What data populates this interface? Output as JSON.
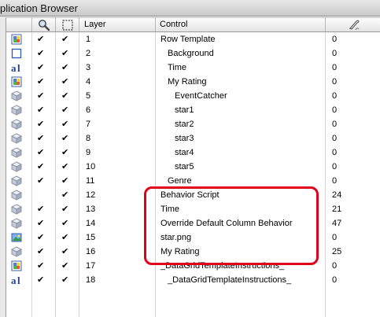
{
  "window": {
    "title": "plication Browser"
  },
  "columns": {
    "icon": "",
    "visible_icon": "magnifier-icon",
    "selectable_icon": "dashed-square-icon",
    "layer": "Layer",
    "control": "Control",
    "script_icon": "script-icon"
  },
  "rows": [
    {
      "icon": "group-icon",
      "vis": "✔",
      "sel": "✔",
      "layer": "1",
      "control": "Row Template",
      "lines": "0"
    },
    {
      "icon": "graphic-icon",
      "vis": "✔",
      "sel": "✔",
      "layer": "2",
      "control": "Background",
      "lines": "0"
    },
    {
      "icon": "field-icon",
      "vis": "✔",
      "sel": "✔",
      "layer": "3",
      "control": "Time",
      "lines": "0"
    },
    {
      "icon": "group-icon",
      "vis": "✔",
      "sel": "✔",
      "layer": "4",
      "control": "My Rating",
      "lines": "0"
    },
    {
      "icon": "button-icon",
      "vis": "✔",
      "sel": "✔",
      "layer": "5",
      "control": "EventCatcher",
      "lines": "0"
    },
    {
      "icon": "button-icon",
      "vis": "✔",
      "sel": "✔",
      "layer": "6",
      "control": "star1",
      "lines": "0"
    },
    {
      "icon": "button-icon",
      "vis": "✔",
      "sel": "✔",
      "layer": "7",
      "control": "star2",
      "lines": "0"
    },
    {
      "icon": "button-icon",
      "vis": "✔",
      "sel": "✔",
      "layer": "8",
      "control": "star3",
      "lines": "0"
    },
    {
      "icon": "button-icon",
      "vis": "✔",
      "sel": "✔",
      "layer": "9",
      "control": "star4",
      "lines": "0"
    },
    {
      "icon": "button-icon",
      "vis": "✔",
      "sel": "✔",
      "layer": "10",
      "control": "star5",
      "lines": "0"
    },
    {
      "icon": "button-icon",
      "vis": "✔",
      "sel": "✔",
      "layer": "11",
      "control": "Genre",
      "lines": "0"
    },
    {
      "icon": "button-icon",
      "vis": "",
      "sel": "✔",
      "layer": "12",
      "control": "Behavior Script",
      "lines": "24"
    },
    {
      "icon": "button-icon",
      "vis": "✔",
      "sel": "✔",
      "layer": "13",
      "control": "Time",
      "lines": "21"
    },
    {
      "icon": "button-icon",
      "vis": "✔",
      "sel": "✔",
      "layer": "14",
      "control": "Override Default Column Behavior",
      "lines": "47"
    },
    {
      "icon": "image-icon",
      "vis": "✔",
      "sel": "✔",
      "layer": "15",
      "control": "star.png",
      "lines": "0"
    },
    {
      "icon": "button-icon",
      "vis": "✔",
      "sel": "✔",
      "layer": "16",
      "control": "My Rating",
      "lines": "25"
    },
    {
      "icon": "group-icon",
      "vis": "✔",
      "sel": "✔",
      "layer": "17",
      "control": "_DataGridTemplateInstructions_",
      "lines": "0"
    },
    {
      "icon": "field-icon",
      "vis": "✔",
      "sel": "✔",
      "layer": "18",
      "control": "_DataGridTemplateInstructions_",
      "lines": "0"
    }
  ],
  "indent_levels": [
    0,
    1,
    1,
    1,
    2,
    2,
    2,
    2,
    2,
    2,
    1,
    0,
    0,
    0,
    0,
    0,
    0,
    1
  ],
  "colors": {
    "highlight": "#e0001a"
  }
}
